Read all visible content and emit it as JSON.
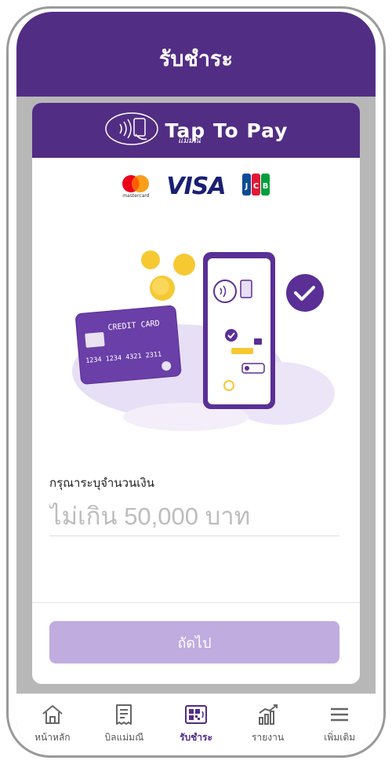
{
  "header": {
    "title": "รับชำระ"
  },
  "banner": {
    "brand": "Tap To Pay",
    "brand_sub": "แม่มณี"
  },
  "card_brands": {
    "visa": "VISA",
    "mastercard_caption": "mastercard",
    "jcb": "JCB"
  },
  "illustration": {
    "card_title": "CREDIT CARD",
    "card_number": "1234 1234 4321 2311"
  },
  "form": {
    "amount_label": "กรุณาระบุจำนวนเงิน",
    "amount_placeholder": "ไม่เกิน 50,000 บาท",
    "amount_value": ""
  },
  "next_button": {
    "label": "ถัดไป"
  },
  "tabbar": {
    "items": [
      {
        "label": "หน้าหลัก",
        "icon": "home-icon"
      },
      {
        "label": "บิลแม่มณี",
        "icon": "receipt-icon"
      },
      {
        "label": "รับชำระ",
        "icon": "qr-payment-icon",
        "active": true
      },
      {
        "label": "รายงาน",
        "icon": "bar-chart-icon"
      },
      {
        "label": "เพิ่มเติม",
        "icon": "menu-icon"
      }
    ]
  },
  "colors": {
    "primary": "#512d84",
    "button_disabled": "#c0acdf",
    "accent_yellow": "#f6c933"
  }
}
